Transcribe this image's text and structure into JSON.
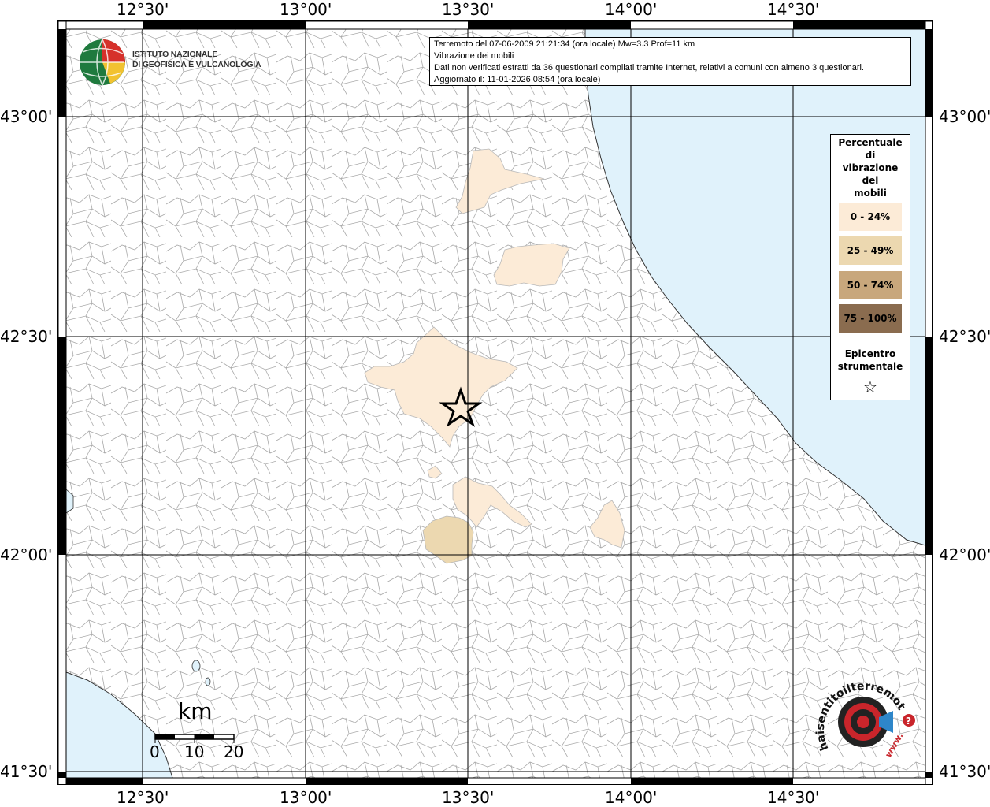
{
  "map": {
    "lon_ticks": [
      "12°30'",
      "13°00'",
      "13°30'",
      "14°00'",
      "14°30'"
    ],
    "lat_ticks": [
      "43°00'",
      "42°30'",
      "42°00'",
      "41°30'"
    ],
    "epicenter": {
      "lat": 42.38,
      "lon": 13.48
    }
  },
  "institute": {
    "line1": "ISTITUTO NAZIONALE",
    "line2": "DI GEOFISICA E VULCANOLOGIA"
  },
  "info": {
    "line1": "Terremoto del 07-06-2009 21:21:34 (ora locale) Mw=3.3 Prof=11 km",
    "line2": "Vibrazione dei mobili",
    "line3": "Dati non verificati estratti da 36 questionari compilati tramite Internet, relativi a comuni con almeno 3 questionari.",
    "line4": "Aggiornato il: 11-01-2026 08:54 (ora locale)"
  },
  "legend": {
    "title": [
      "Percentuale",
      "di",
      "vibrazione",
      "del",
      "mobili"
    ],
    "classes": [
      {
        "label": "0 - 24%",
        "color": "#fcebd7"
      },
      {
        "label": "25 - 49%",
        "color": "#ecd8b0"
      },
      {
        "label": "50 - 74%",
        "color": "#c8a77c"
      },
      {
        "label": "75 - 100%",
        "color": "#8a6c4f"
      }
    ],
    "epicenter_label": [
      "Epicentro",
      "strumentale"
    ],
    "star": "☆"
  },
  "scale": {
    "unit": "km",
    "labels": [
      "0",
      "10",
      "20"
    ]
  },
  "badge": {
    "text": "haisentitoilterremoto.it",
    "www": "www.",
    "question": "?"
  },
  "colors": {
    "sea": "#e0f2fb",
    "grid": "#000000",
    "boundary": "#9a9a9a"
  }
}
